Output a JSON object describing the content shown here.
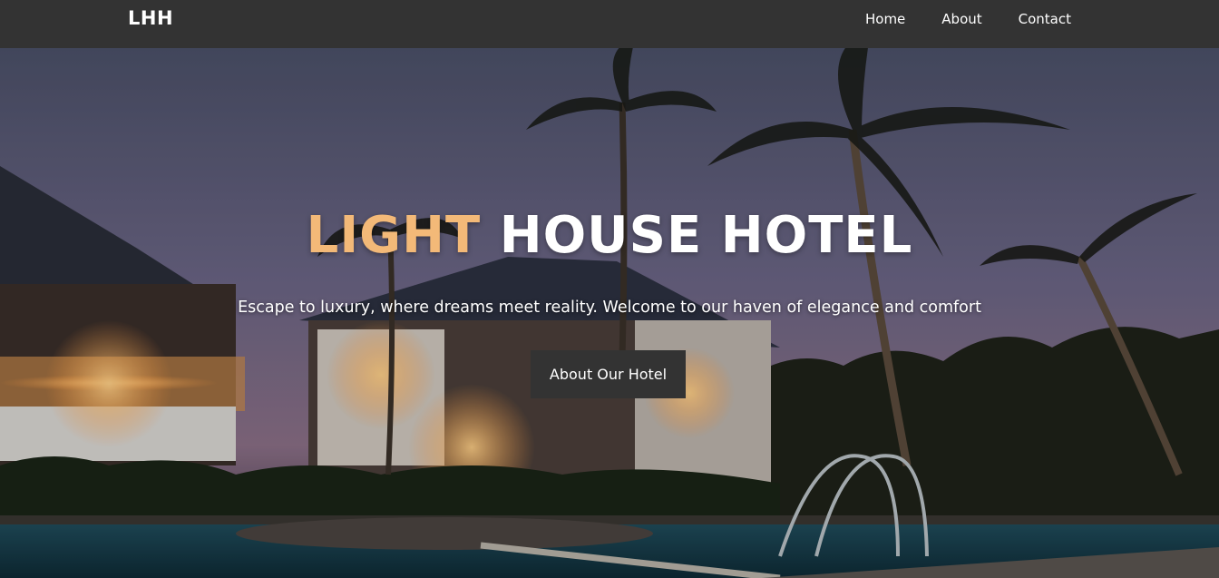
{
  "navbar": {
    "brand": "LHH",
    "links": [
      "Home",
      "About",
      "Contact"
    ]
  },
  "hero": {
    "title_accent": "LIGHT",
    "title_rest": "HOUSE HOTEL",
    "tagline": "Escape to luxury, where dreams meet reality. Welcome to our haven of elegance and comfort",
    "cta_label": "About Our Hotel"
  },
  "colors": {
    "navbar_bg": "#333333",
    "accent": "#f3b978",
    "text": "#ffffff"
  }
}
